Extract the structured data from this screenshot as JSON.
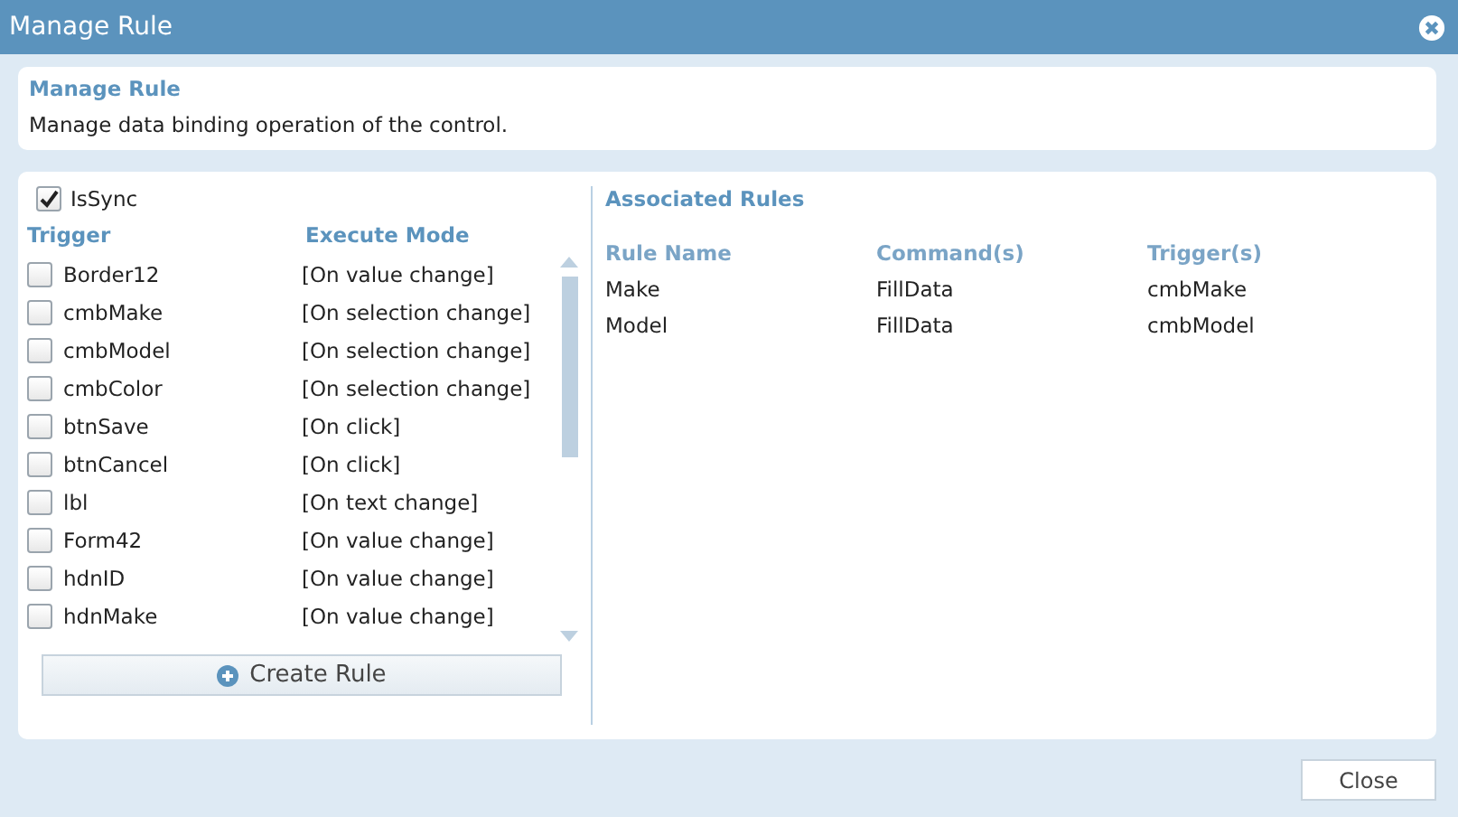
{
  "window": {
    "title": "Manage Rule"
  },
  "header": {
    "title": "Manage Rule",
    "description": "Manage data binding operation of the control."
  },
  "is_sync": {
    "label": "IsSync",
    "checked": true
  },
  "trigger_list": {
    "columns": [
      "Trigger",
      "Execute Mode"
    ],
    "rows": [
      {
        "trigger": "Border12",
        "mode": "[On value change]",
        "checked": false
      },
      {
        "trigger": "cmbMake",
        "mode": "[On selection change]",
        "checked": false
      },
      {
        "trigger": "cmbModel",
        "mode": "[On selection change]",
        "checked": false
      },
      {
        "trigger": "cmbColor",
        "mode": "[On selection change]",
        "checked": false
      },
      {
        "trigger": "btnSave",
        "mode": "[On click]",
        "checked": false
      },
      {
        "trigger": "btnCancel",
        "mode": "[On click]",
        "checked": false
      },
      {
        "trigger": "lbl",
        "mode": "[On text change]",
        "checked": false
      },
      {
        "trigger": "Form42",
        "mode": "[On value change]",
        "checked": false
      },
      {
        "trigger": "hdnID",
        "mode": "[On value change]",
        "checked": false
      },
      {
        "trigger": "hdnMake",
        "mode": "[On value change]",
        "checked": false
      }
    ]
  },
  "create_button": {
    "label": "Create Rule"
  },
  "associated_rules": {
    "title": "Associated Rules",
    "columns": [
      "Rule Name",
      "Command(s)",
      "Trigger(s)"
    ],
    "rows": [
      [
        "Make",
        "FillData",
        "cmbMake"
      ],
      [
        "Model",
        "FillData",
        "cmbModel"
      ]
    ]
  },
  "footer": {
    "buttons": [
      "Close"
    ]
  }
}
